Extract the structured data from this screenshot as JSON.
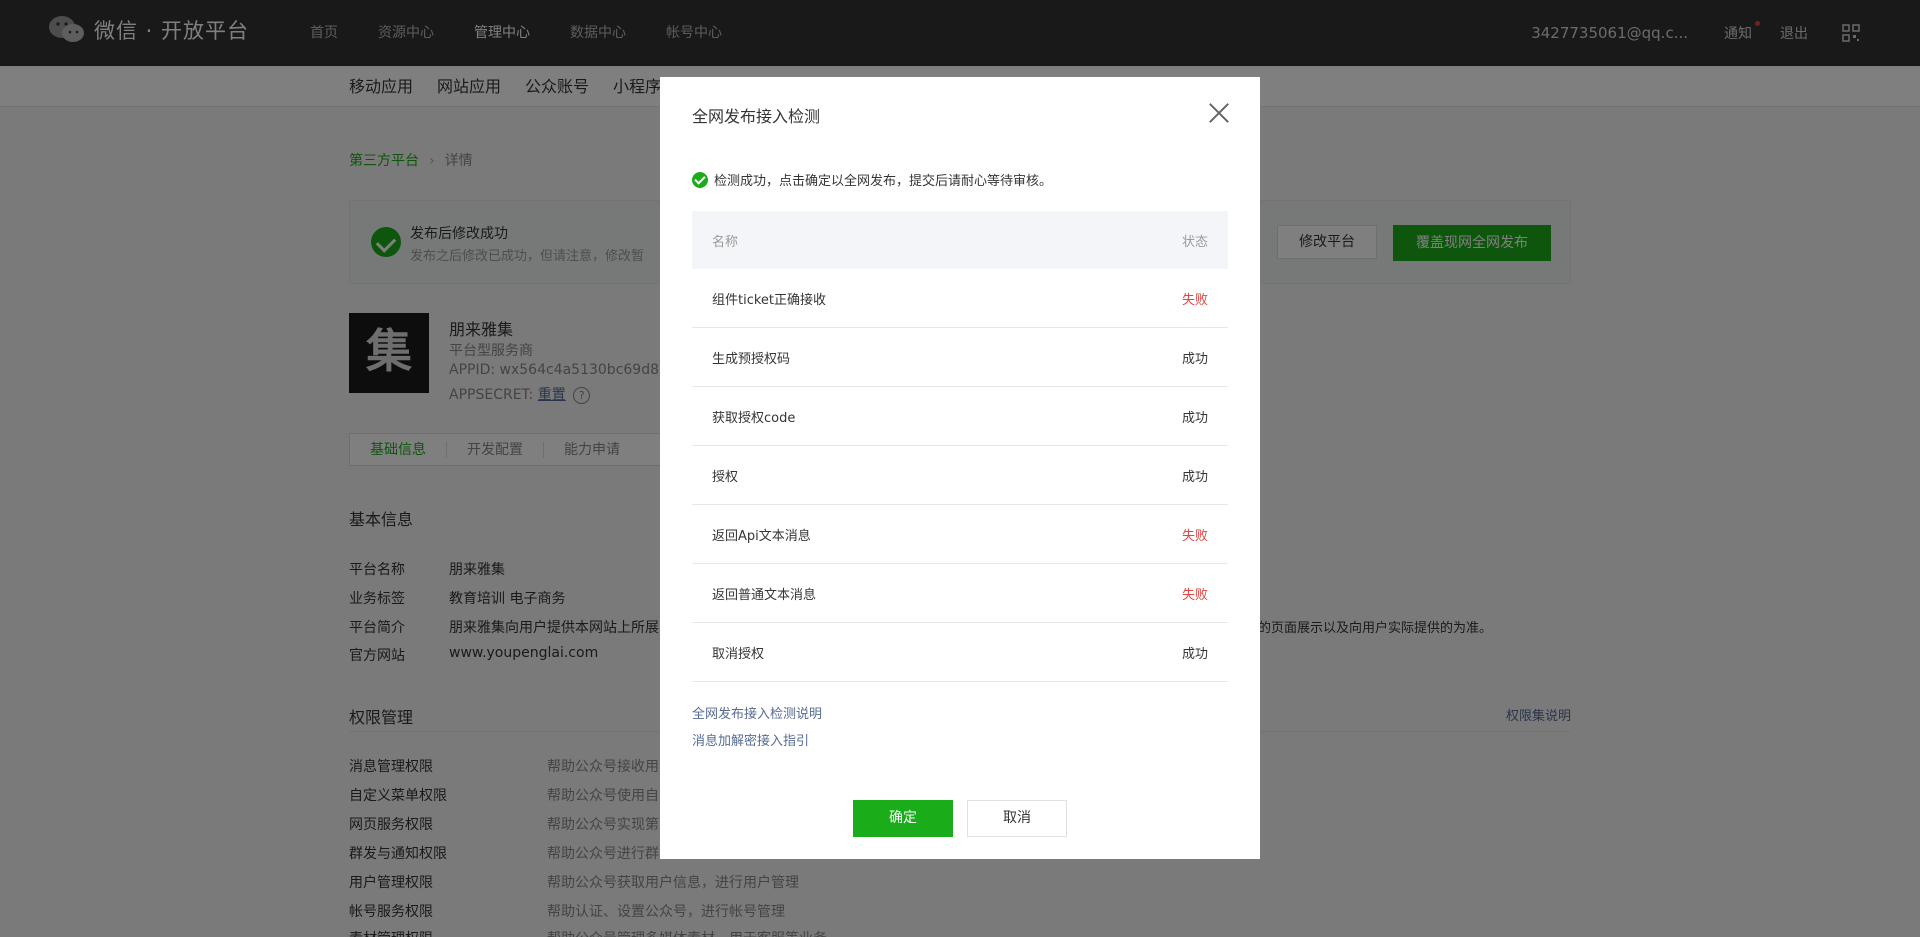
{
  "header": {
    "logo_text": "微信 · 开放平台",
    "nav": [
      "首页",
      "资源中心",
      "管理中心",
      "数据中心",
      "帐号中心"
    ],
    "active_nav": "管理中心",
    "email": "3427735061@qq.c...",
    "notice": "通知",
    "logout": "退出"
  },
  "subnav": [
    "移动应用",
    "网站应用",
    "公众账号",
    "小程序"
  ],
  "breadcrumb": {
    "root": "第三方平台",
    "sep": "›",
    "current": "详情"
  },
  "banner": {
    "title": "发布后修改成功",
    "desc": "发布之后修改已成功，但请注意，修改暂",
    "modify_btn": "修改平台",
    "publish_btn": "覆盖现网全网发布"
  },
  "app": {
    "logo_char": "集",
    "name": "朋来雅集",
    "type": "平台型服务商",
    "appid": "APPID: wx564c4a5130bc69d8",
    "secret_label": "APPSECRET:",
    "reset": "重置",
    "help": "?"
  },
  "tabs": [
    "基础信息",
    "开发配置",
    "能力申请"
  ],
  "basic": {
    "title": "基本信息",
    "rows": [
      {
        "k": "平台名称",
        "v": "朋来雅集"
      },
      {
        "k": "业务标签",
        "v": "教育培训 电子商务"
      },
      {
        "k": "平台简介",
        "v": "朋来雅集向用户提供本网站上所展"
      },
      {
        "k": "官方网站",
        "v": "www.youpenglai.com"
      }
    ],
    "intro_tail": "的页面展示以及向用户实际提供的为准。"
  },
  "perm": {
    "title": "权限管理",
    "explain": "权限集说明",
    "rows": [
      {
        "k": "消息管理权限",
        "v": "帮助公众号接收用"
      },
      {
        "k": "自定义菜单权限",
        "v": "帮助公众号使用自"
      },
      {
        "k": "网页服务权限",
        "v": "帮助公众号实现第"
      },
      {
        "k": "群发与通知权限",
        "v": "帮助公众号进行群"
      },
      {
        "k": "用户管理权限",
        "v": "帮助公众号获取用户信息，进行用户管理"
      },
      {
        "k": "帐号服务权限",
        "v": "帮助认证、设置公众号，进行帐号管理"
      },
      {
        "k": "素材管理权限",
        "v": "帮助公众号管理多媒体素材，用于客服等业务"
      }
    ]
  },
  "dialog": {
    "title": "全网发布接入检测",
    "status": "检测成功，点击确定以全网发布，提交后请耐心等待审核。",
    "col_name": "名称",
    "col_status": "状态",
    "rows": [
      {
        "name": "组件ticket正确接收",
        "status": "失败",
        "ok": false
      },
      {
        "name": "生成预授权码",
        "status": "成功",
        "ok": true
      },
      {
        "name": "获取授权code",
        "status": "成功",
        "ok": true
      },
      {
        "name": "授权",
        "status": "成功",
        "ok": true
      },
      {
        "name": "返回Api文本消息",
        "status": "失败",
        "ok": false
      },
      {
        "name": "返回普通文本消息",
        "status": "失败",
        "ok": false
      },
      {
        "name": "取消授权",
        "status": "成功",
        "ok": true
      }
    ],
    "link1": "全网发布接入检测说明",
    "link2": "消息加解密接入指引",
    "ok_btn": "确定",
    "cancel_btn": "取消"
  },
  "colors": {
    "brand": "#1aad19",
    "fail": "#e64340",
    "link": "#576b95",
    "topbar": "#333333"
  }
}
